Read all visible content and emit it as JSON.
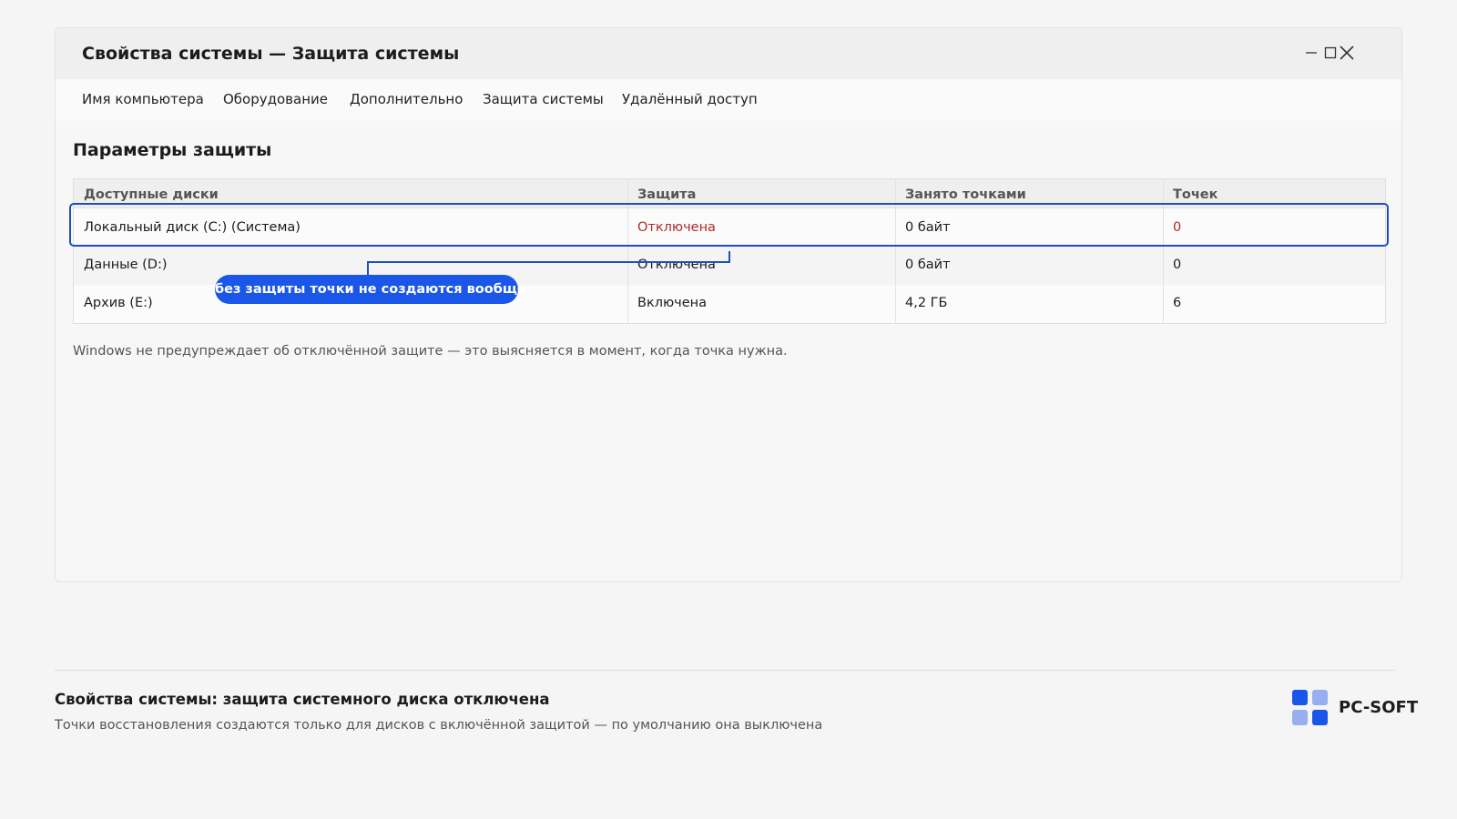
{
  "window": {
    "title": "Свойства системы — Защита системы"
  },
  "tabs": [
    {
      "label": "Имя компьютера"
    },
    {
      "label": "Оборудование"
    },
    {
      "label": "Дополнительно"
    },
    {
      "label": "Защита системы"
    },
    {
      "label": "Удалённый доступ"
    }
  ],
  "section": {
    "title": "Параметры защиты"
  },
  "table": {
    "columns": [
      "Доступные диски",
      "Защита",
      "Занято точками",
      "Точек"
    ],
    "rows": [
      {
        "disk": "Локальный диск (C:) (Система)",
        "protection": "Отключена",
        "used": "0 байт",
        "points": "0"
      },
      {
        "disk": "Данные (D:)",
        "protection": "Отключена",
        "used": "0 байт",
        "points": "0"
      },
      {
        "disk": "Архив (E:)",
        "protection": "Включена",
        "used": "4,2 ГБ",
        "points": "6"
      }
    ]
  },
  "callout": {
    "text": "без защиты точки не создаются вообще"
  },
  "note": "Windows не предупреждает об отключённой защите — это выясняется в момент, когда точка нужна.",
  "footer": {
    "title": "Свойства системы: защита системного диска отключена",
    "subtitle": "Точки восстановления создаются только для дисков с включённой защитой — по умолчанию она выключена"
  },
  "brand": {
    "name": "PC-SOFT",
    "icon": "pc-soft-logo-icon"
  },
  "colors": {
    "accent": "#1a56e8",
    "highlight_border": "#1f4fbf",
    "danger_text": "#b02a2a"
  }
}
